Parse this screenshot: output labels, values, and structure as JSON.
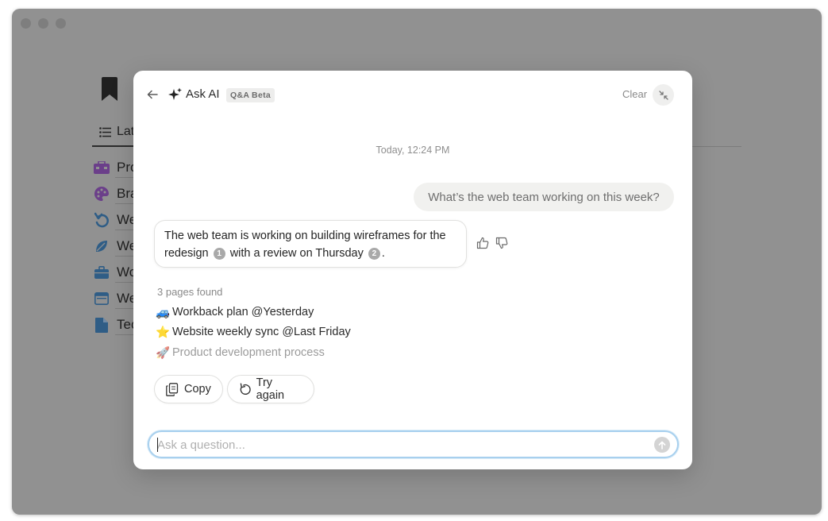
{
  "background": {
    "tab_label": "Lat",
    "rows": [
      {
        "label": "Pro",
        "icon": "toolbox-icon"
      },
      {
        "label": "Bra",
        "icon": "palette-icon"
      },
      {
        "label": "We",
        "icon": "undo-arrow-icon"
      },
      {
        "label": "We",
        "icon": "leaf-icon"
      },
      {
        "label": "Wo",
        "icon": "briefcase-icon"
      },
      {
        "label": "We",
        "icon": "browser-window-icon"
      },
      {
        "label": "Tec",
        "icon": "document-icon"
      }
    ]
  },
  "modal": {
    "title": "Ask AI",
    "badge": "Q&A Beta",
    "clear_label": "Clear",
    "timestamp": "Today, 12:24 PM",
    "user_message": "What’s the web team working on this week?",
    "ai_response": {
      "part1": "The web team is working on building wireframes for the redesign",
      "cite1": "1",
      "part2": "with a review on Thursday",
      "cite2": "2",
      "part3": "."
    },
    "pages_found": "3 pages found",
    "sources": [
      {
        "emoji": "🚙",
        "label": "Workback plan @Yesterday"
      },
      {
        "emoji": "⭐",
        "label": "Website weekly sync @Last Friday"
      },
      {
        "emoji": "🚀",
        "label": "Product development process"
      }
    ],
    "copy_label": "Copy",
    "try_again_label": "Try again",
    "input_placeholder": "Ask a question..."
  },
  "colors": {
    "overlay": "#919191",
    "input_focus": "#a8d0ee",
    "purple_icon": "#6b3f8a",
    "blue_icon": "#2f5d86"
  }
}
